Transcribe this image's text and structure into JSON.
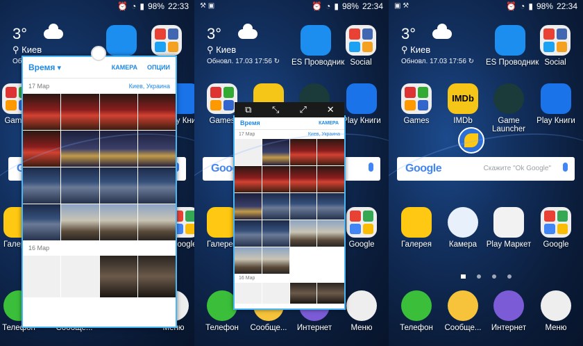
{
  "panels": [
    {
      "status": {
        "left_icons": "",
        "battery": "98%",
        "time": "22:33"
      }
    },
    {
      "status": {
        "left_icons": "⚒ ▣",
        "battery": "98%",
        "time": "22:34"
      }
    },
    {
      "status": {
        "left_icons": "▣ ⚒",
        "battery": "98%",
        "time": "22:34"
      }
    }
  ],
  "weather": {
    "temp": "3°",
    "city": "Киев",
    "updated": "Обновл. 17.03 17:56"
  },
  "apps": {
    "es": "ES Проводник",
    "social": "Social",
    "games": "Games",
    "imdb": "IMDb",
    "imdb_logo": "IMDb",
    "game_launcher": "Game Launcher",
    "play_books": "Play Книги",
    "gallery": "Галерея",
    "camera": "Камера",
    "play_market": "Play Маркет",
    "google": "Google",
    "phone": "Телефон",
    "messages": "Сообще...",
    "internet": "Интернет",
    "menu": "Меню"
  },
  "search": {
    "logo": "Google",
    "placeholder": "Скажите \"Ok Google\""
  },
  "gallery_popup": {
    "header": "Время",
    "camera": "КАМЕРА",
    "options": "ОПЦИИ",
    "date1": "17 Мар",
    "location": "Киев, Украина",
    "date2": "16 Мар"
  },
  "float_bar": {
    "b1": "⧉",
    "b2": "⤡",
    "b3": "⤢",
    "b4": "✕"
  },
  "colors": {
    "accent": "#49b7f5",
    "brand_blue": "#1e88e5"
  }
}
